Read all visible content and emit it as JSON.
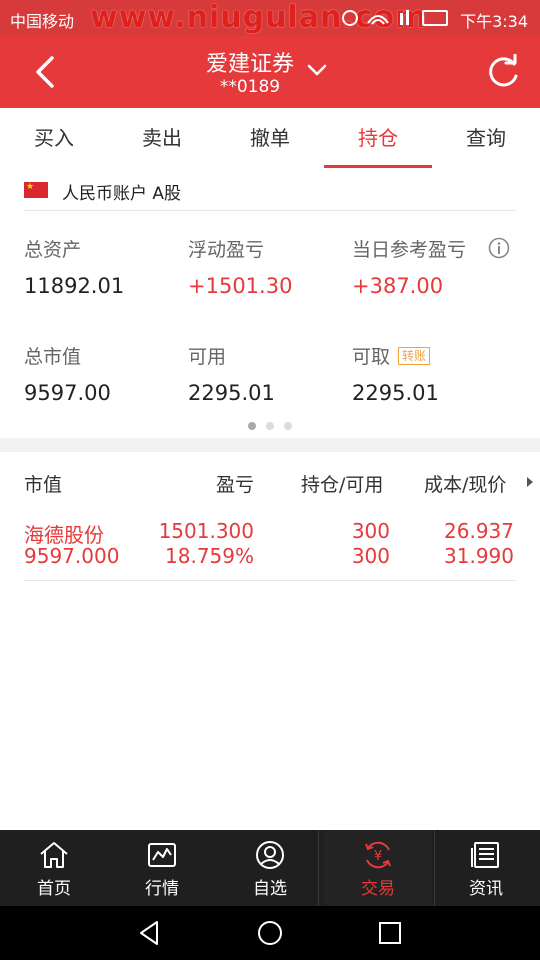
{
  "status_bar": {
    "carrier": "中国移动",
    "watermark": "www.niugulan.com",
    "time": "下午3:34"
  },
  "header": {
    "title": "爱建证券",
    "account": "**0189"
  },
  "tabs": [
    {
      "label": "买入",
      "active": false
    },
    {
      "label": "卖出",
      "active": false
    },
    {
      "label": "撤单",
      "active": false
    },
    {
      "label": "持仓",
      "active": true
    },
    {
      "label": "查询",
      "active": false
    }
  ],
  "account_row": {
    "label": "人民币账户 A股"
  },
  "summary": {
    "total_assets": {
      "label": "总资产",
      "value": "11892.01"
    },
    "floating_pl": {
      "label": "浮动盈亏",
      "value": "+1501.30"
    },
    "daily_pl": {
      "label": "当日参考盈亏",
      "value": "+387.00"
    },
    "market_value": {
      "label": "总市值",
      "value": "9597.00"
    },
    "available": {
      "label": "可用",
      "value": "2295.01"
    },
    "withdrawable": {
      "label": "可取",
      "value": "2295.01",
      "badge": "转账"
    }
  },
  "pager": {
    "total": 3,
    "active": 0
  },
  "holdings": {
    "columns": [
      "市值",
      "盈亏",
      "持仓/可用",
      "成本/现价"
    ],
    "rows": [
      {
        "name": "海德股份",
        "market_value": "9597.000",
        "pl": "1501.300",
        "pl_pct": "18.759%",
        "position": "300",
        "available": "300",
        "cost": "26.937",
        "price": "31.990"
      }
    ]
  },
  "bottom_nav": [
    {
      "label": "首页",
      "icon": "home-icon",
      "active": false
    },
    {
      "label": "行情",
      "icon": "market-chart-icon",
      "active": false
    },
    {
      "label": "自选",
      "icon": "user-circle-icon",
      "active": false
    },
    {
      "label": "交易",
      "icon": "yuan-exchange-icon",
      "active": true
    },
    {
      "label": "资讯",
      "icon": "news-icon",
      "active": false
    }
  ],
  "colors": {
    "brand_red": "#e5393b",
    "badge_orange": "#f0a640",
    "nav_bg": "#1f1f1f"
  }
}
